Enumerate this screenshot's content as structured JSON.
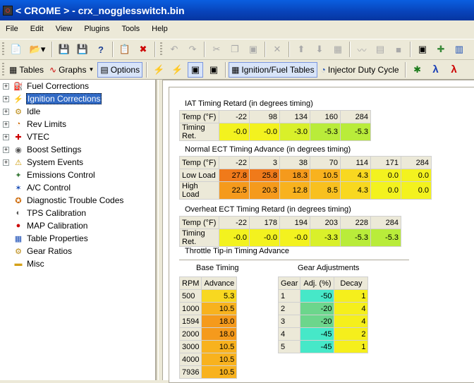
{
  "window": {
    "title": "< CROME > - crx_nogglesswitch.bin"
  },
  "menu": [
    "File",
    "Edit",
    "View",
    "Plugins",
    "Tools",
    "Help"
  ],
  "toolbar2": {
    "tables": "Tables",
    "graphs": "Graphs",
    "options": "Options",
    "ignition_fuel_tables": "Ignition/Fuel Tables",
    "injector_duty_cycle": "Injector Duty Cycle"
  },
  "tree": [
    {
      "label": "Fuel Corrections",
      "icon": "fuel-icon",
      "expandable": true
    },
    {
      "label": "Ignition Corrections",
      "icon": "ignition-icon",
      "expandable": true,
      "selected": true
    },
    {
      "label": "Idle",
      "icon": "idle-icon",
      "expandable": true
    },
    {
      "label": "Rev Limits",
      "icon": "rev-icon",
      "expandable": true
    },
    {
      "label": "VTEC",
      "icon": "vtec-icon",
      "expandable": true
    },
    {
      "label": "Boost Settings",
      "icon": "boost-icon",
      "expandable": true
    },
    {
      "label": "System Events",
      "icon": "warning-icon",
      "expandable": true
    },
    {
      "label": "Emissions Control",
      "icon": "emissions-icon",
      "expandable": false
    },
    {
      "label": "A/C Control",
      "icon": "ac-icon",
      "expandable": false
    },
    {
      "label": "Diagnostic Trouble Codes",
      "icon": "dtc-icon",
      "expandable": false
    },
    {
      "label": "TPS Calibration",
      "icon": "tps-icon",
      "expandable": false
    },
    {
      "label": "MAP Calibration",
      "icon": "map-icon",
      "expandable": false
    },
    {
      "label": "Table Properties",
      "icon": "table-icon",
      "expandable": false
    },
    {
      "label": "Gear Ratios",
      "icon": "gear-icon",
      "expandable": false
    },
    {
      "label": "Misc",
      "icon": "folder-icon",
      "expandable": false
    }
  ],
  "iat": {
    "title": "IAT Timing Retard (in degrees timing)",
    "row_labels": [
      "Temp (°F)",
      "Timing Ret."
    ],
    "temps": [
      "-22",
      "98",
      "134",
      "160",
      "284"
    ],
    "values": [
      "-0.0",
      "-0.0",
      "-3.0",
      "-5.3",
      "-5.3"
    ]
  },
  "normal_ect": {
    "title": "Normal ECT Timing Advance (in degrees timing)",
    "row_labels": [
      "Temp (°F)",
      "Low Load",
      "High Load"
    ],
    "temps": [
      "-22",
      "3",
      "38",
      "70",
      "114",
      "171",
      "284"
    ],
    "low": [
      "27.8",
      "25.8",
      "18.3",
      "10.5",
      "4.3",
      "0.0",
      "0.0"
    ],
    "high": [
      "22.5",
      "20.3",
      "12.8",
      "8.5",
      "4.3",
      "0.0",
      "0.0"
    ]
  },
  "overheat_ect": {
    "title": "Overheat ECT Timing Retard (in degrees timing)",
    "row_labels": [
      "Temp (°F)",
      "Timing Ret."
    ],
    "temps": [
      "-22",
      "178",
      "194",
      "203",
      "228",
      "284"
    ],
    "values": [
      "-0.0",
      "-0.0",
      "-0.0",
      "-3.3",
      "-5.3",
      "-5.3"
    ]
  },
  "tipin": {
    "title": "Throttle Tip-in Timing Advance",
    "base_title": "Base Timing",
    "gear_title": "Gear Adjustments",
    "base_headers": [
      "RPM",
      "Advance"
    ],
    "rpm": [
      "500",
      "1000",
      "1594",
      "2000",
      "3000",
      "4000",
      "7936"
    ],
    "advance": [
      "5.3",
      "10.5",
      "18.0",
      "18.0",
      "10.5",
      "10.5",
      "10.5"
    ],
    "gear_headers": [
      "Gear",
      "Adj. (%)",
      "Decay"
    ],
    "gear": [
      "1",
      "2",
      "3",
      "4",
      "5"
    ],
    "adj": [
      "-50",
      "-20",
      "-20",
      "-45",
      "-45"
    ],
    "decay": [
      "1",
      "4",
      "4",
      "2",
      "1"
    ]
  }
}
